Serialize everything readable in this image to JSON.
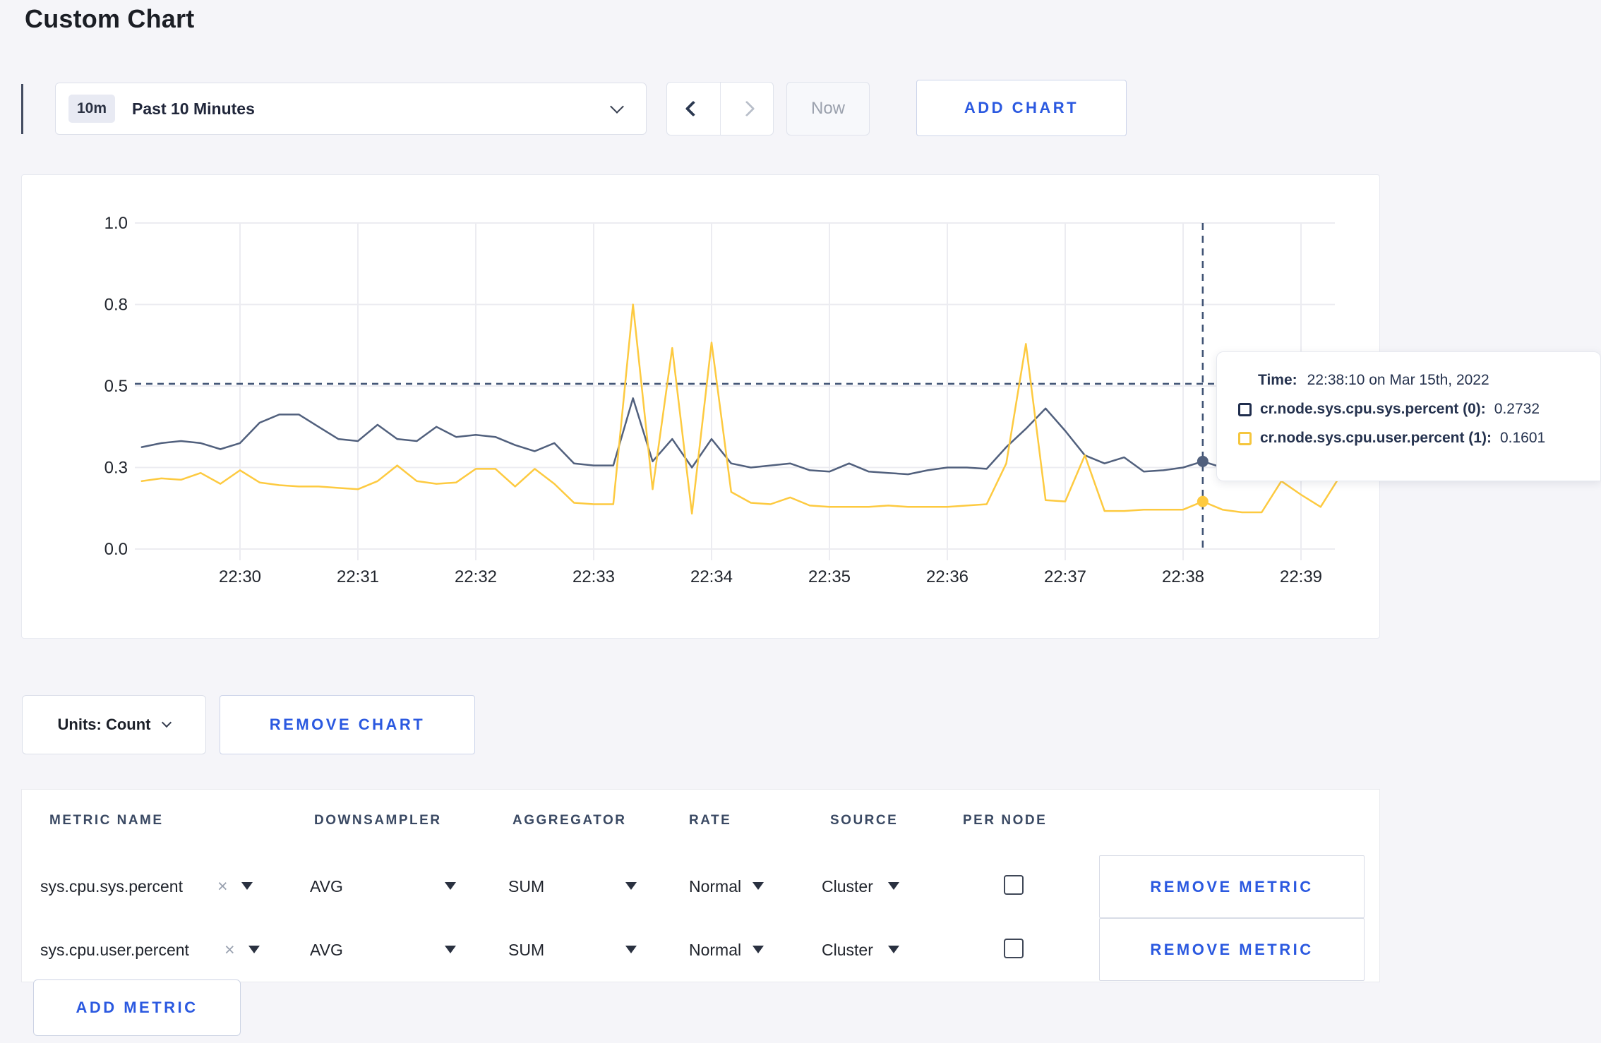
{
  "page": {
    "title": "Custom Chart"
  },
  "colors": {
    "accent_blue": "#2b59e0",
    "series_sys": "#51607d",
    "series_user": "#fdca40",
    "crosshair": "#3f5273",
    "gridline": "#ececf1"
  },
  "toolbar": {
    "time_range": {
      "badge": "10m",
      "label": "Past 10 Minutes",
      "chevron_icon": "chevron-down"
    },
    "prev_icon": "chevron-left",
    "next_icon": "chevron-right",
    "now_label": "Now",
    "add_chart_label": "ADD CHART"
  },
  "chart_tooltip": {
    "time_label": "Time:",
    "time_value": "22:38:10 on Mar 15th, 2022",
    "series": [
      {
        "label": "cr.node.sys.cpu.sys.percent (0):",
        "value": "0.2732",
        "color": "#1f2d4d"
      },
      {
        "label": "cr.node.sys.cpu.user.percent (1):",
        "value": "0.1601",
        "color": "#f5c63d"
      }
    ]
  },
  "chart_data": {
    "type": "line",
    "title": "",
    "xlabel": "",
    "ylabel": "",
    "grid": true,
    "legend_position": "tooltip-overlay",
    "y_ticks": [
      0.0,
      0.3,
      0.5,
      0.8,
      1.0
    ],
    "y_tick_labels": [
      "0.0",
      "0.3",
      "0.5",
      "0.8",
      "1.0"
    ],
    "x_tick_labels": [
      "22:30",
      "22:31",
      "22:32",
      "22:33",
      "22:34",
      "22:35",
      "22:36",
      "22:37",
      "22:38",
      "22:39"
    ],
    "x_start_time": "22:29:10",
    "first_tick_offset_seconds": 50,
    "tick_interval_seconds": 60,
    "sample_interval_seconds": 10,
    "series": [
      {
        "name": "cr.node.sys.cpu.sys.percent",
        "color": "#51607d",
        "values": [
          0.35,
          0.36,
          0.365,
          0.36,
          0.345,
          0.36,
          0.41,
          0.43,
          0.43,
          0.4,
          0.37,
          0.365,
          0.405,
          0.37,
          0.365,
          0.4,
          0.375,
          0.38,
          0.375,
          0.355,
          0.34,
          0.36,
          0.31,
          0.305,
          0.305,
          0.47,
          0.315,
          0.37,
          0.3,
          0.37,
          0.31,
          0.3,
          0.305,
          0.31,
          0.29,
          0.285,
          0.31,
          0.285,
          0.28,
          0.275,
          0.29,
          0.3,
          0.3,
          0.295,
          0.35,
          0.395,
          0.445,
          0.39,
          0.33,
          0.31,
          0.325,
          0.285,
          0.29,
          0.3,
          0.315,
          0.3,
          0.29,
          0.3,
          0.3,
          0.295,
          0.3,
          0.3
        ]
      },
      {
        "name": "cr.node.sys.cpu.user.percent",
        "color": "#fdca40",
        "values": [
          0.25,
          0.26,
          0.255,
          0.28,
          0.24,
          0.29,
          0.245,
          0.235,
          0.23,
          0.23,
          0.225,
          0.22,
          0.25,
          0.305,
          0.25,
          0.24,
          0.245,
          0.295,
          0.295,
          0.23,
          0.295,
          0.24,
          0.17,
          0.165,
          0.165,
          0.8,
          0.22,
          0.64,
          0.13,
          0.66,
          0.21,
          0.17,
          0.165,
          0.19,
          0.16,
          0.155,
          0.155,
          0.155,
          0.16,
          0.155,
          0.155,
          0.155,
          0.16,
          0.165,
          0.31,
          0.655,
          0.18,
          0.175,
          0.33,
          0.14,
          0.14,
          0.145,
          0.145,
          0.145,
          0.175,
          0.145,
          0.135,
          0.135,
          0.25,
          0.2,
          0.155,
          0.27
        ]
      }
    ],
    "crosshair": {
      "hover_index": 54,
      "hover_time": "22:38:10",
      "guideline_value": 0.508
    }
  },
  "chart_controls": {
    "units_label": "Units: Count",
    "units_chevron_icon": "chevron-down",
    "remove_chart_label": "REMOVE CHART"
  },
  "metrics_table": {
    "headers": [
      "METRIC NAME",
      "DOWNSAMPLER",
      "AGGREGATOR",
      "RATE",
      "SOURCE",
      "PER NODE"
    ],
    "rows": [
      {
        "metric": "sys.cpu.sys.percent",
        "remove_icon": "x",
        "downsampler": "AVG",
        "aggregator": "SUM",
        "rate": "Normal",
        "source": "Cluster",
        "per_node_checked": false,
        "remove_label": "REMOVE METRIC"
      },
      {
        "metric": "sys.cpu.user.percent",
        "remove_icon": "x",
        "downsampler": "AVG",
        "aggregator": "SUM",
        "rate": "Normal",
        "source": "Cluster",
        "per_node_checked": false,
        "remove_label": "REMOVE METRIC"
      }
    ],
    "add_metric_label": "ADD METRIC"
  }
}
